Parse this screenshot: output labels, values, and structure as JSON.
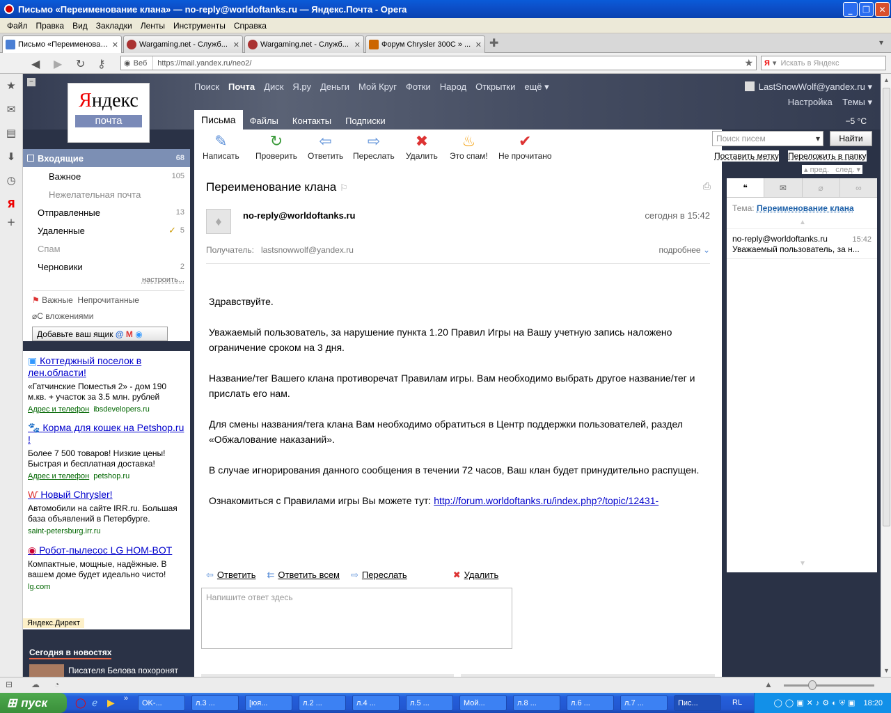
{
  "window": {
    "title": "Письмо «Переименование клана» — no-reply@worldoftanks.ru — Яндекс.Почта - Opera"
  },
  "menu": [
    "Файл",
    "Правка",
    "Вид",
    "Закладки",
    "Ленты",
    "Инструменты",
    "Справка"
  ],
  "tabs": [
    {
      "label": "Письмо «Переименован...",
      "color": "#4a7fd4"
    },
    {
      "label": "Wargaming.net - Служб...",
      "color": "#a33"
    },
    {
      "label": "Wargaming.net - Служб...",
      "color": "#a33"
    },
    {
      "label": "Форум Chrysler 300C » ...",
      "color": "#c60"
    }
  ],
  "address": {
    "web_label": "Веб",
    "url": "https://mail.yandex.ru/neo2/",
    "search_placeholder": "Искать в Яндекс"
  },
  "header": {
    "logo_text_red": "Я",
    "logo_text": "ндекс",
    "logo_sub": "почта",
    "nav": [
      "Поиск",
      "Почта",
      "Диск",
      "Я.ру",
      "Деньги",
      "Мой Круг",
      "Фотки",
      "Народ",
      "Открытки",
      "ещё ▾"
    ],
    "user": "LastSnowWolf@yandex.ru ▾",
    "settings": "Настройка",
    "themes": "Темы ▾",
    "temperature": "−5 °С",
    "subtabs": [
      "Письма",
      "Файлы",
      "Контакты",
      "Подписки"
    ]
  },
  "toolbar": {
    "buttons": [
      {
        "label": "Написать",
        "icon": "✎",
        "color": "#5b8fd8"
      },
      {
        "label": "Проверить",
        "icon": "↻",
        "color": "#3a9a3a"
      },
      {
        "label": "Ответить",
        "icon": "⇦",
        "color": "#5b8fd8"
      },
      {
        "label": "Переслать",
        "icon": "⇨",
        "color": "#5b8fd8"
      },
      {
        "label": "Удалить",
        "icon": "✖",
        "color": "#d33"
      },
      {
        "label": "Это спам!",
        "icon": "♨",
        "color": "#f39a00"
      },
      {
        "label": "Не прочитано",
        "icon": "✔",
        "color": "#d33"
      }
    ],
    "search_placeholder": "Поиск писем",
    "find": "Найти",
    "put_label": "Поставить метку",
    "move": "Переложить в папку"
  },
  "folders": [
    {
      "name": "Входящие",
      "count": "68"
    },
    {
      "name": "Важное",
      "count": "105"
    },
    {
      "name": "Нежелательная почта",
      "count": ""
    },
    {
      "name": "Отправленные",
      "count": "13"
    },
    {
      "name": "Удаленные",
      "count": "5"
    },
    {
      "name": "Спам",
      "count": ""
    },
    {
      "name": "Черновики",
      "count": "2"
    }
  ],
  "sidebar": {
    "configure": "настроить...",
    "important": "Важные",
    "unread": "Непрочитанные",
    "attachments": "С вложениями",
    "add_box": "Добавьте ваш ящик"
  },
  "ads": [
    {
      "title": "Коттеджный поселок в лен.области!",
      "text": "«Гатчинские Поместья 2» - дом 190 м.кв. + участок за 3.5 млн. рублей",
      "link1": "Адрес и телефон",
      "domain": "ibsdevelopers.ru"
    },
    {
      "title": "Корма для кошек на Petshop.ru !",
      "text": "Более 7 500 товаров! Низкие цены! Быстрая и бесплатная доставка!",
      "link1": "Адрес и телефон",
      "domain": "petshop.ru"
    },
    {
      "title": "Новый Chrysler!",
      "text": "Автомобили на сайте IRR.ru. Большая база объявлений в Петербурге.",
      "link1": "",
      "domain": "saint-petersburg.irr.ru"
    },
    {
      "title": "Робот-пылесос LG HOM-BOT",
      "text": "Компактные, мощные, надёжные. В вашем доме будет идеально чисто!",
      "link1": "",
      "domain": "lg.com"
    }
  ],
  "direct": "Яндекс.Директ",
  "news": {
    "title": "Сегодня в новостях",
    "item": "Писателя Белова похоронят"
  },
  "message": {
    "subject": "Переименование клана",
    "from": "no-reply@worldoftanks.ru",
    "date": "сегодня в 15:42",
    "to_label": "Получатель:",
    "to": "lastsnowwolf@yandex.ru",
    "more": "подробнее",
    "body": [
      "Здравствуйте.",
      "Уважаемый пользователь, за нарушение пункта 1.20 Правил Игры на Вашу учетную запись наложено ограничение сроком на 3 дня.",
      "Название/тег Вашего клана противоречат Правилам игры. Вам необходимо выбрать другое название/тег и прислать его нам.",
      "Для смены названия/тега клана Вам необходимо обратиться в Центр поддержки пользователей, раздел «Обжалование наказаний».",
      "В случае игнорирования данного сообщения в течении 72 часов, Ваш клан будет принудительно распущен."
    ],
    "link_prefix": "Ознакомиться с Правилами игры Вы можете тут: ",
    "link": "http://forum.worldoftanks.ru/index.php?/topic/12431-",
    "actions": [
      "Ответить",
      "Ответить всем",
      "Переслать",
      "Удалить"
    ],
    "reply_placeholder": "Напишите ответ здесь"
  },
  "thread": {
    "prev": "▴ пред.",
    "next": "след. ▾",
    "topic_label": "Тема:",
    "topic": "Переименование клана",
    "from": "no-reply@worldoftanks.ru",
    "time": "15:42",
    "preview": "Уважаемый пользователь, за н..."
  },
  "taskbar": {
    "start": "пуск",
    "items": [
      "OK-...",
      "л.3 ...",
      "[юя...",
      "л.2 ...",
      "л.4 ...",
      "л.5 ...",
      "Мой...",
      "л.8 ...",
      "л.6 ...",
      "л.7 ...",
      "Пис..."
    ],
    "lang": "RL",
    "clock": "18:20"
  }
}
